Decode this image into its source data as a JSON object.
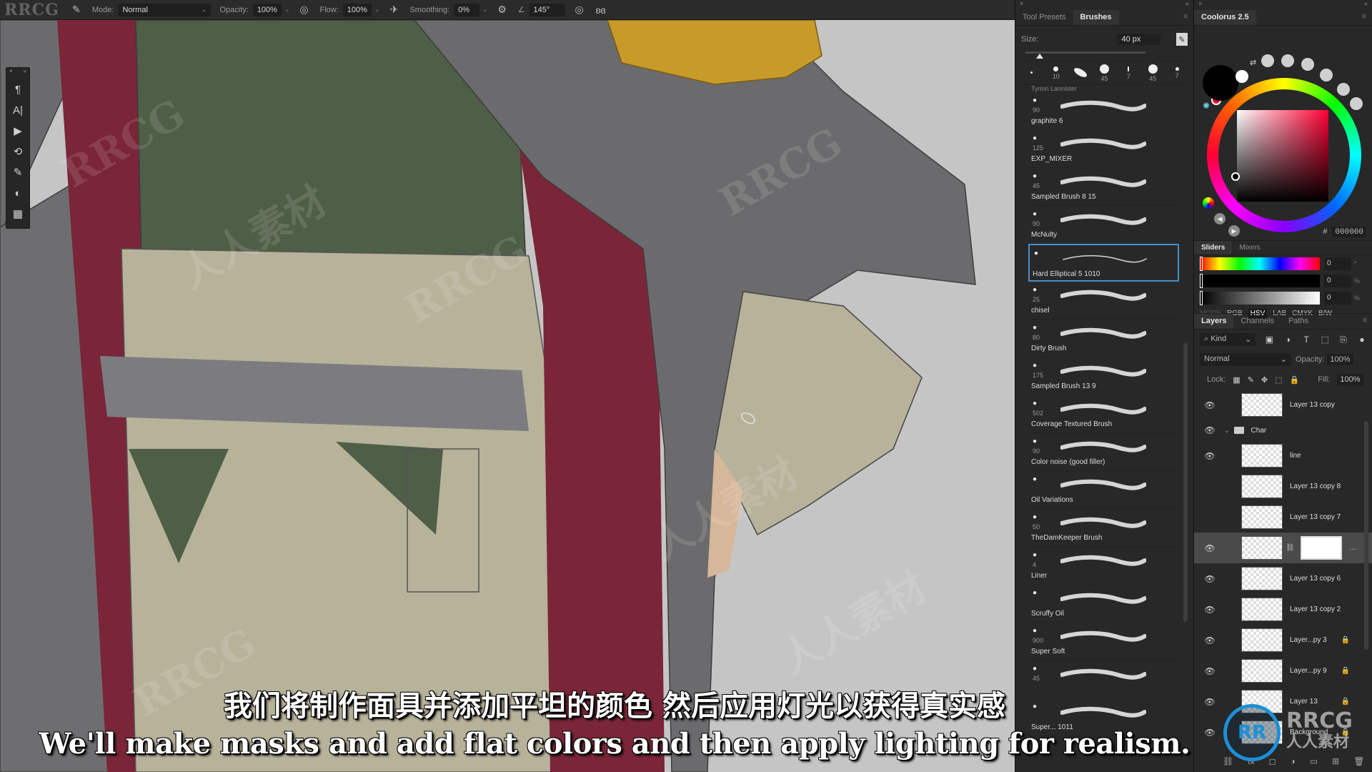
{
  "options_bar": {
    "watermark_logo": "RRCG",
    "mode_label": "Mode:",
    "mode_value": "Normal",
    "opacity_label": "Opacity:",
    "opacity_value": "100%",
    "flow_label": "Flow:",
    "flow_value": "100%",
    "smoothing_label": "Smoothing:",
    "smoothing_value": "0%",
    "angle_value": "145°"
  },
  "toolstrip": {
    "tools": [
      {
        "name": "paragraph-icon",
        "glyph": "¶"
      },
      {
        "name": "character-icon",
        "glyph": "A|"
      },
      {
        "name": "play-action-icon",
        "glyph": "▶"
      },
      {
        "name": "history-icon",
        "glyph": "⟲"
      },
      {
        "name": "brush-settings-icon",
        "glyph": "✎"
      },
      {
        "name": "adjustments-icon",
        "glyph": "◐"
      },
      {
        "name": "properties-icon",
        "glyph": "▦"
      }
    ]
  },
  "brush_panel": {
    "tabs": [
      "Tool Presets",
      "Brushes"
    ],
    "active_tab": "Brushes",
    "size_label": "Size:",
    "size_value": "40 px",
    "size_fraction": 0.12,
    "recent_brushes": [
      {
        "size": ""
      },
      {
        "size": "10"
      },
      {
        "size": ""
      },
      {
        "size": "45"
      },
      {
        "size": "7"
      },
      {
        "size": "45"
      },
      {
        "size": "7"
      }
    ],
    "partial_top_label": "Tyrion Lannister",
    "brushes": [
      {
        "name": "graphite 6",
        "size": "90"
      },
      {
        "name": "EXP_MIXER",
        "size": "125"
      },
      {
        "name": "Sampled Brush 8 15",
        "size": "45"
      },
      {
        "name": "McNulty",
        "size": "90"
      },
      {
        "name": "Hard Elliptical 5 1010",
        "size": "",
        "selected": true
      },
      {
        "name": "chisel",
        "size": "25"
      },
      {
        "name": "Dirty Brush",
        "size": "80"
      },
      {
        "name": "Sampled Brush 13 9",
        "size": "175"
      },
      {
        "name": "Coverage Textured Brush",
        "size": "502"
      },
      {
        "name": "Color noise (good filler)",
        "size": "90"
      },
      {
        "name": "Oil Variations",
        "size": ""
      },
      {
        "name": "TheDamKeeper Brush",
        "size": "50"
      },
      {
        "name": "Liner",
        "size": "4"
      },
      {
        "name": "Scruffy Oil",
        "size": ""
      },
      {
        "name": "Super Soft",
        "size": "900"
      },
      {
        "name": "",
        "size": "45"
      },
      {
        "name": "Super... 1011",
        "size": ""
      }
    ]
  },
  "coolorus": {
    "title": "Coolorus 2.5",
    "foreground_color": "#000000",
    "background_color": "#ffffff",
    "hex_label": "#",
    "hex_value": "000000",
    "slider_tabs": [
      "Sliders",
      "Mixers"
    ],
    "active_slider_tab": "Sliders",
    "sliders": [
      {
        "channel": "H",
        "value": "0",
        "unit": "°"
      },
      {
        "channel": "S",
        "value": "0",
        "unit": "%"
      },
      {
        "channel": "V",
        "value": "0",
        "unit": "%"
      }
    ],
    "mode_label": "MODE",
    "modes": [
      "RGB",
      "HSV",
      "LAB",
      "CMYK",
      "B/W"
    ],
    "active_mode": "HSV"
  },
  "layers_panel": {
    "tabs": [
      "Layers",
      "Channels",
      "Paths"
    ],
    "active_tab": "Layers",
    "filter_label": "Kind",
    "blend_mode": "Normal",
    "opacity_label": "Opacity:",
    "opacity_value": "100%",
    "lock_label": "Lock:",
    "fill_label": "Fill:",
    "fill_value": "100%",
    "layers": [
      {
        "name": "Layer 13 copy",
        "visible": true,
        "locked": false
      },
      {
        "name": "Char",
        "type": "group",
        "visible": true,
        "expanded": true
      },
      {
        "name": "line",
        "visible": true,
        "locked": false
      },
      {
        "name": "Layer 13 copy 8",
        "visible": false,
        "locked": false
      },
      {
        "name": "Layer 13 copy 7",
        "visible": false,
        "locked": false
      },
      {
        "name": "",
        "visible": true,
        "locked": false,
        "selected": true,
        "has_mask": true
      },
      {
        "name": "Layer 13 copy 6",
        "visible": true,
        "locked": false
      },
      {
        "name": "Layer 13 copy 2",
        "visible": true,
        "locked": false
      },
      {
        "name": "Layer...py 3",
        "visible": true,
        "locked": true
      },
      {
        "name": "Layer...py 9",
        "visible": true,
        "locked": true
      },
      {
        "name": "Layer 13",
        "visible": true,
        "locked": true
      },
      {
        "name": "Background",
        "visible": true,
        "locked": true
      }
    ]
  },
  "subtitles": {
    "zh": "我们将制作面具并添加平坦的颜色 然后应用灯光以获得真实感",
    "en": "We'll make masks and add flat colors and then apply lighting for realism."
  },
  "watermark": {
    "badge": "RR",
    "brand": "RRCG",
    "brand_sub": "人人素材",
    "tiles": [
      "RRCG",
      "人人素材"
    ]
  },
  "canvas_colors": {
    "background": "#c5c5c5",
    "coat_gray": "#6b6b6d",
    "sash_red": "#7a2538",
    "vest_green": "#4f5e46",
    "trousers_beige": "#b7b29a",
    "belt_gray": "#7c7c80",
    "epaulette_gold": "#c79a2a",
    "skin": "#d6b79a"
  }
}
